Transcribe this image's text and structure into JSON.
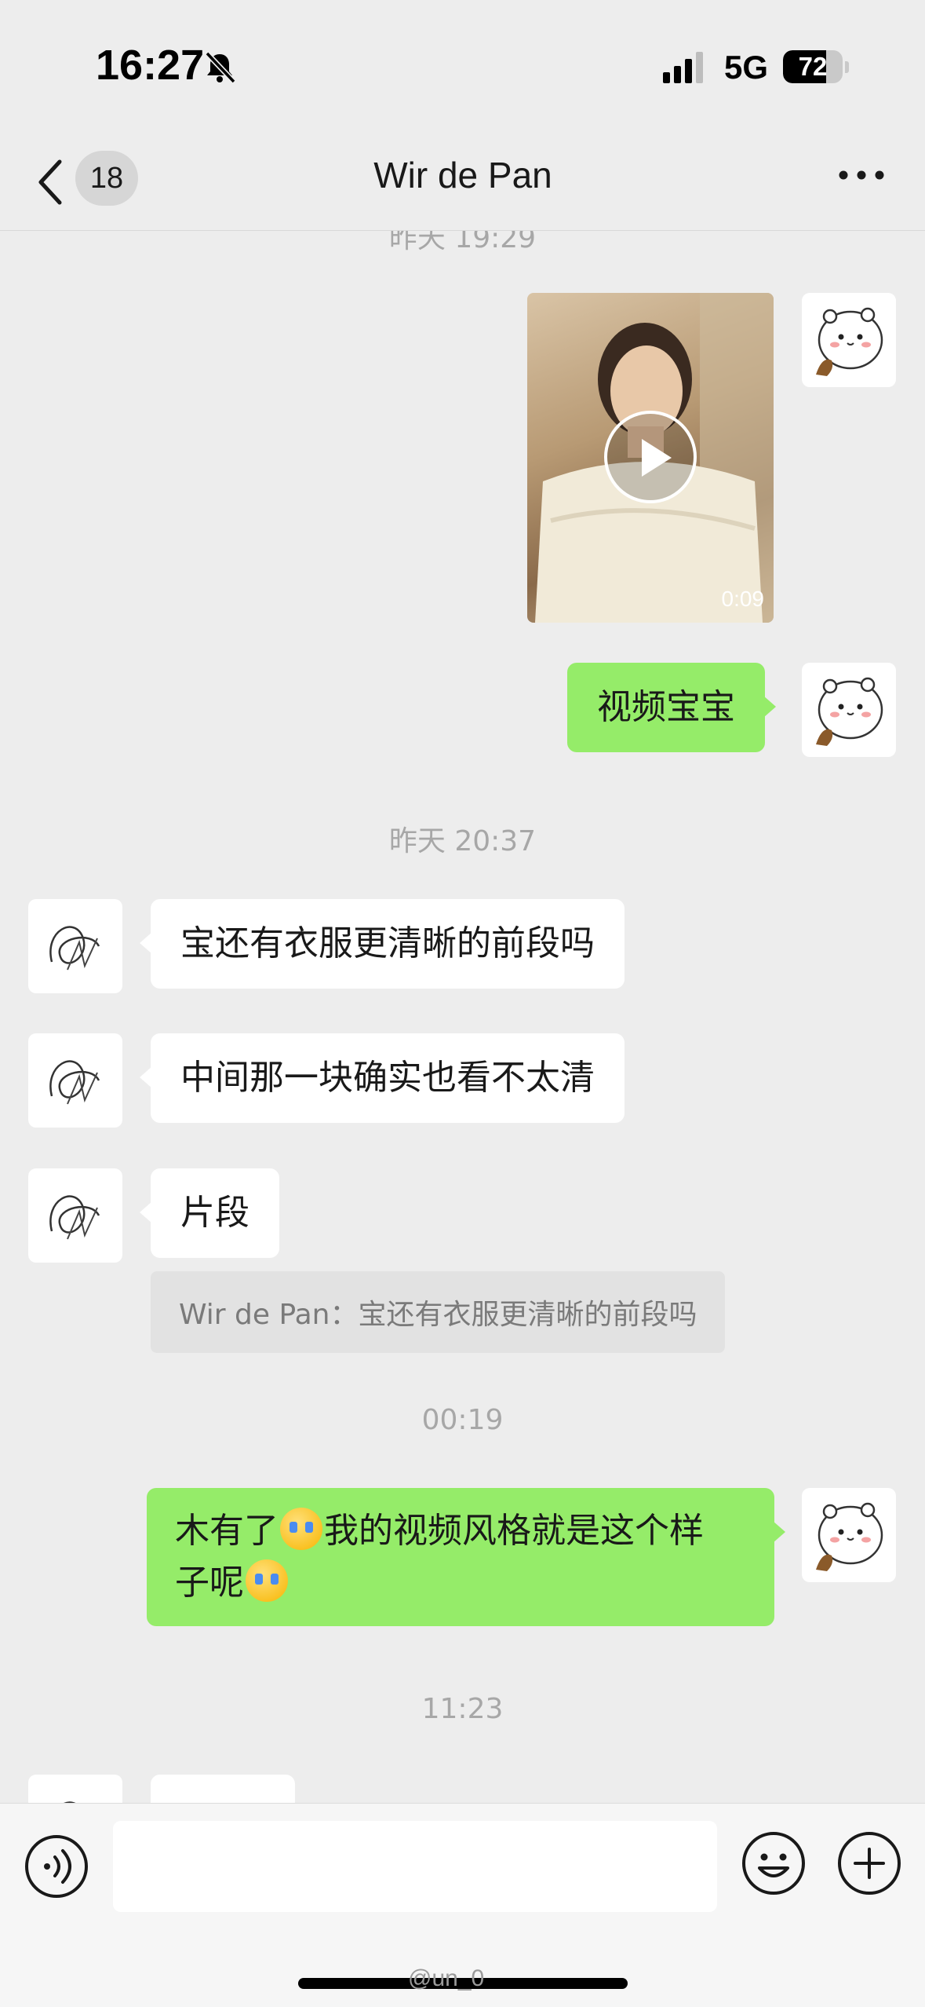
{
  "status": {
    "time": "16:27",
    "network": "5G",
    "battery_level": 72,
    "battery": "72"
  },
  "nav": {
    "unread_count": "18",
    "title": "Wir de Pan"
  },
  "messages": {
    "ts_top": "昨天 19:29",
    "video_duration": "0:09",
    "out1": "视频宝宝",
    "ts_2": "昨天 20:37",
    "in1": "宝还有衣服更清晰的前段吗",
    "in2": "中间那一块确实也看不太清",
    "in3": "片段",
    "quote": "Wir de Pan：宝还有衣服更清晰的前段吗",
    "ts_3": "00:19",
    "out2_a": "木有了",
    "out2_b": "我的视频风格就是这个样",
    "out2_c": "子呢",
    "ts_4": "11:23"
  },
  "watermark": "@un_0",
  "icons": {
    "mute": "bell-slash-icon",
    "back": "chevron-left-icon",
    "more": "more-dots-icon",
    "voice": "voice-icon",
    "emoji": "smiley-icon",
    "plus": "plus-circle-icon",
    "sticker": "crying-face-emoji"
  }
}
